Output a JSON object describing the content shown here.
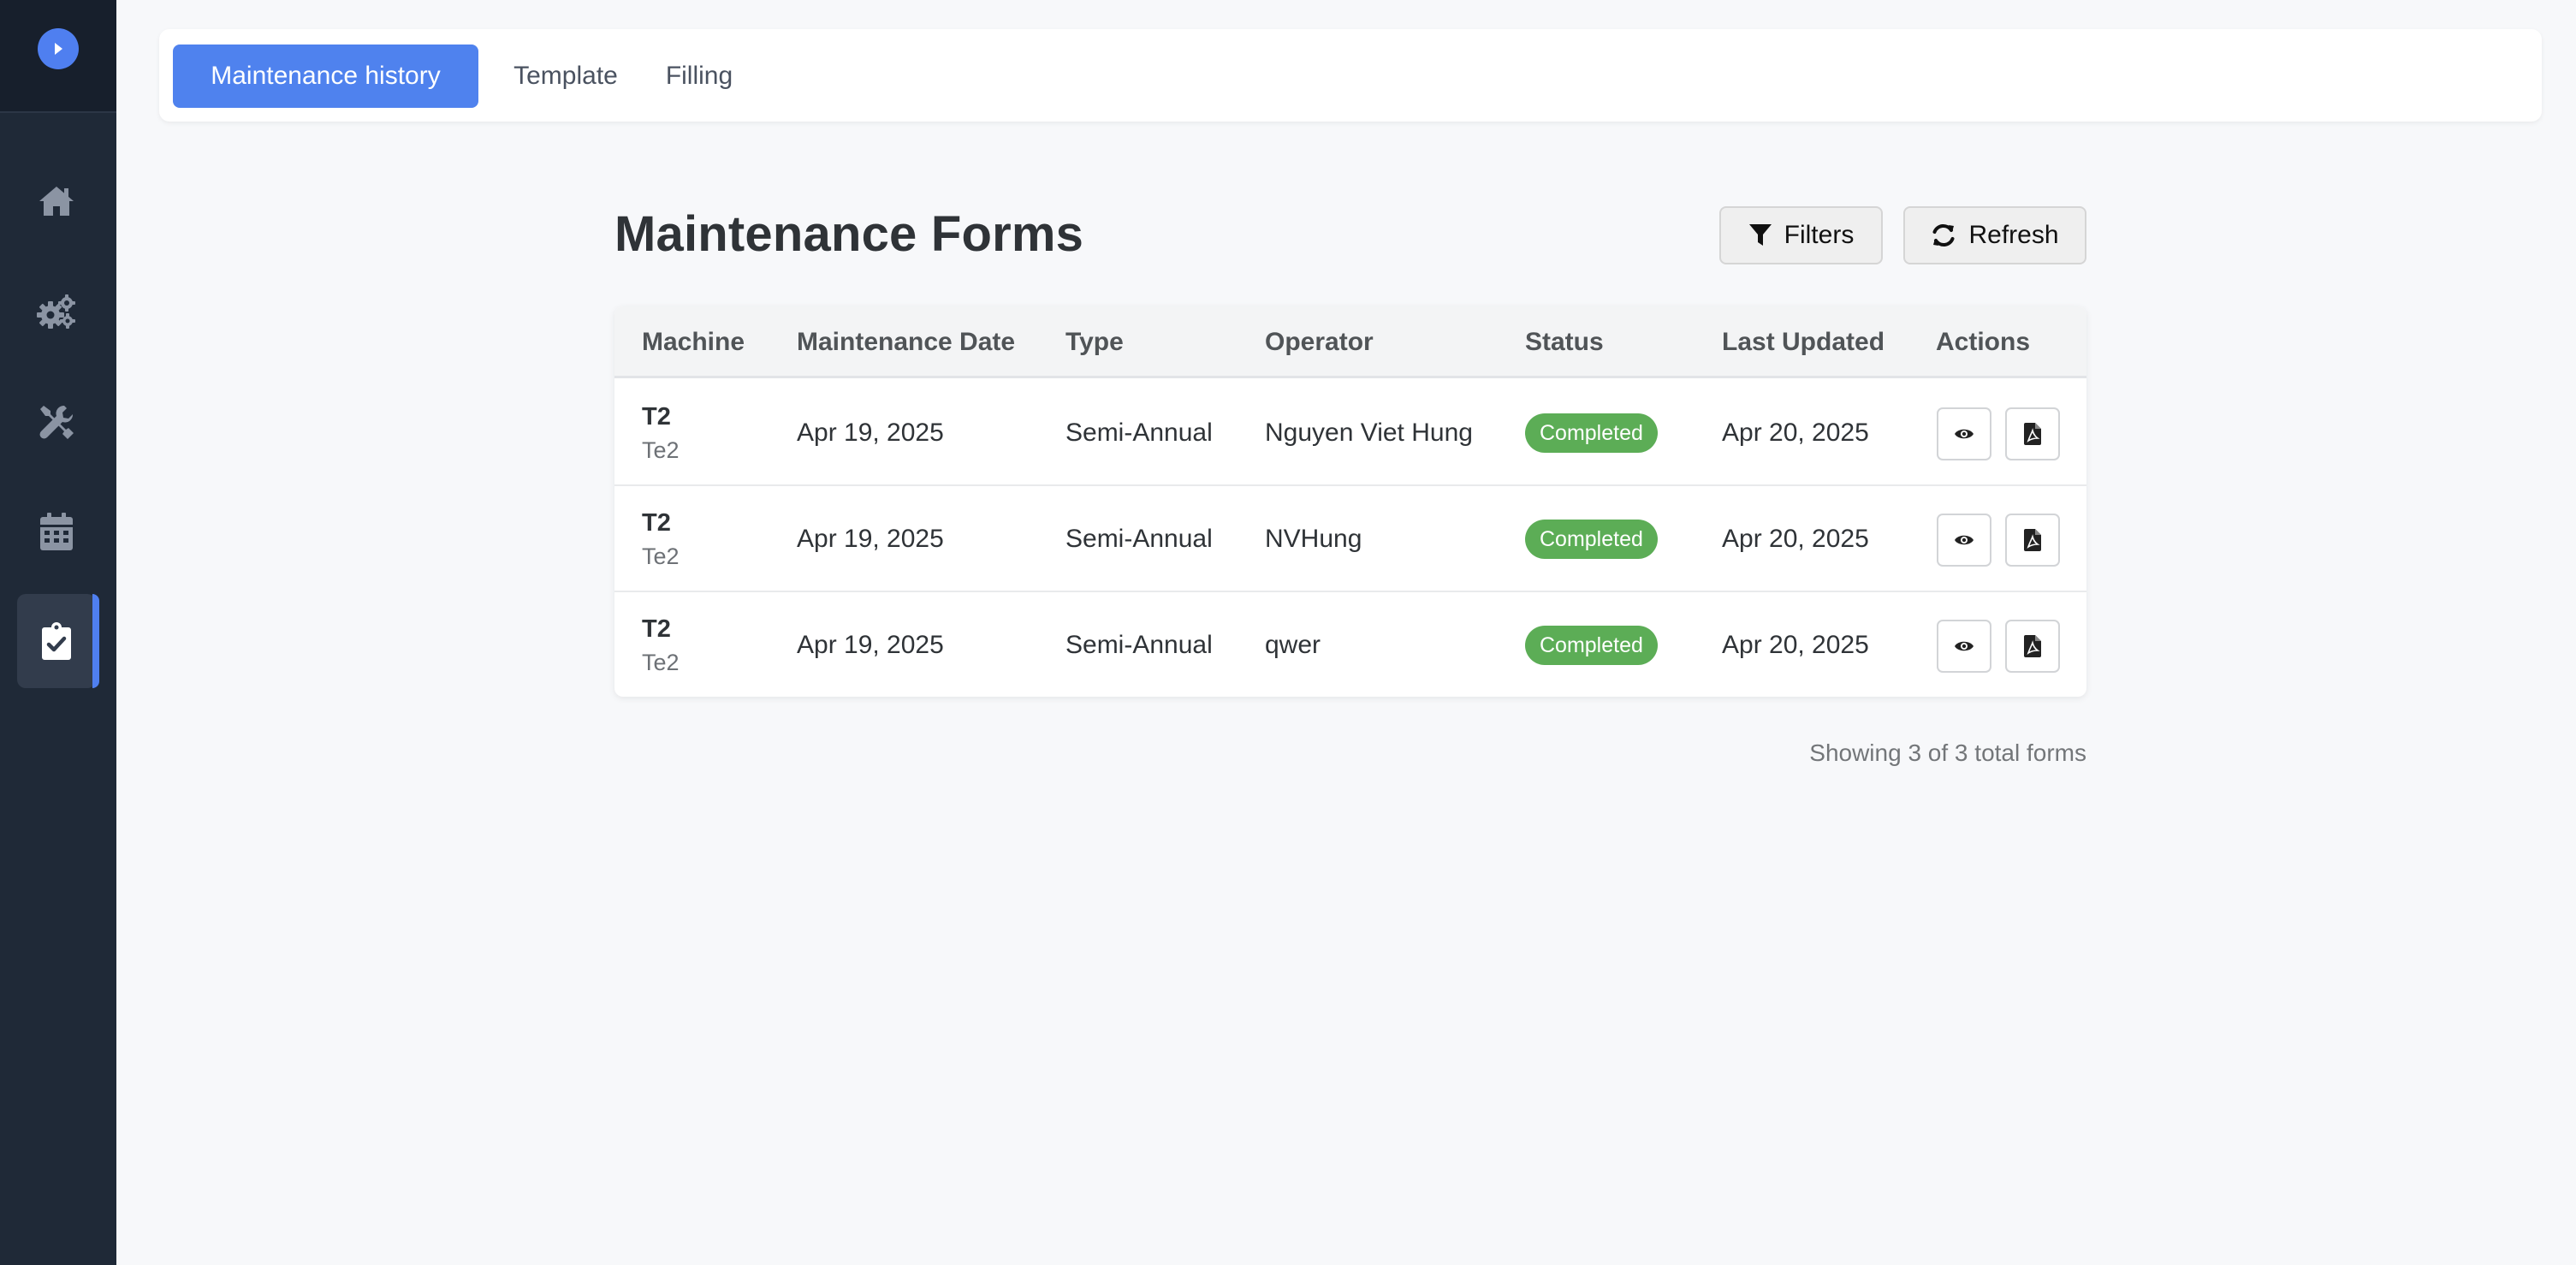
{
  "tabs": [
    {
      "label": "Maintenance history",
      "active": true
    },
    {
      "label": "Template",
      "active": false
    },
    {
      "label": "Filling",
      "active": false
    }
  ],
  "sidebar": {
    "items": [
      {
        "icon": "home-icon",
        "active": false
      },
      {
        "icon": "gears-icon",
        "active": false
      },
      {
        "icon": "tools-icon",
        "active": false
      },
      {
        "icon": "calendar-icon",
        "active": false
      },
      {
        "icon": "clipboard-check-icon",
        "active": true
      }
    ]
  },
  "main": {
    "title": "Maintenance Forms",
    "filters_label": "Filters",
    "refresh_label": "Refresh",
    "footer": "Showing 3 of 3 total forms"
  },
  "table": {
    "headers": [
      "Machine",
      "Maintenance Date",
      "Type",
      "Operator",
      "Status",
      "Last Updated",
      "Actions"
    ],
    "rows": [
      {
        "machine": "T2",
        "machine_sub": "Te2",
        "date": "Apr 19, 2025",
        "type": "Semi-Annual",
        "operator": "Nguyen Viet Hung",
        "status": "Completed",
        "updated": "Apr 20, 2025"
      },
      {
        "machine": "T2",
        "machine_sub": "Te2",
        "date": "Apr 19, 2025",
        "type": "Semi-Annual",
        "operator": "NVHung",
        "status": "Completed",
        "updated": "Apr 20, 2025"
      },
      {
        "machine": "T2",
        "machine_sub": "Te2",
        "date": "Apr 19, 2025",
        "type": "Semi-Annual",
        "operator": "qwer",
        "status": "Completed",
        "updated": "Apr 20, 2025"
      }
    ]
  },
  "colors": {
    "accent": "#4f82ee",
    "sidebar": "#1f2937",
    "status_completed": "#5cad56"
  }
}
